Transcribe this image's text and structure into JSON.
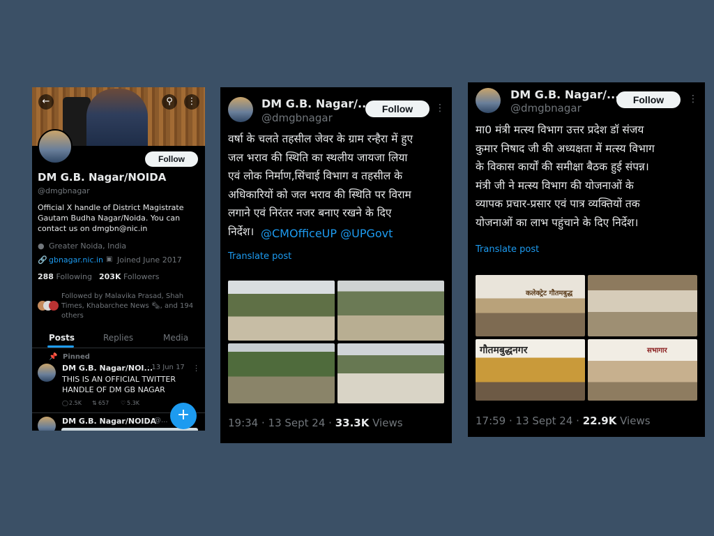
{
  "profile": {
    "name": "DM G.B. Nagar/NOIDA",
    "handle": "@dmgbnagar",
    "follow_label": "Follow",
    "bio_lines": [
      "Official X handle of District Magistrate",
      "Gautam Budha Nagar/Noida. You can",
      "contact us on dmgbn@nic.in"
    ],
    "location": "Greater Noida, India",
    "website": "gbnagar.nic.in",
    "joined": "Joined June 2017",
    "following_count": "288",
    "following_label": "Following",
    "followers_count": "203K",
    "followers_label": "Followers",
    "followed_by_lines": [
      "Followed by Malavika Prasad, Shah",
      "Times, Khabarchee News 🗞, and 194",
      "others"
    ],
    "tabs": [
      "Posts",
      "Replies",
      "Media"
    ],
    "pinned_label": "Pinned",
    "pinned_tweet": {
      "author": "DM G.B. Nagar/NOI...",
      "date": "· 13 Jun 17",
      "text_lines": [
        "THIS IS AN OFFICIAL TWITTER",
        "HANDLE OF DM GB NAGAR"
      ],
      "replies": "2.5K",
      "retweets": "657",
      "likes": "5.3K"
    },
    "next_tweet_author": "DM G.B. Nagar/NOIDA",
    "next_tweet_handle": "@..."
  },
  "post1": {
    "name": "DM G.B. Nagar/...",
    "handle": "@dmgbnagar",
    "follow_label": "Follow",
    "text": "वर्षा के चलते तहसील जेवर के ग्राम रन्हैरा में हुए\nजल भराव की स्थिति का स्थलीय जायजा लिया\nएवं लोक निर्माण,सिंचाई विभाग व तहसील के\nअधिकारियों को जल भराव की स्थिति पर विराम\nलगाने एवं निरंतर नजर बनाए रखने के दिए\nनिर्देश।",
    "mentions": "@CMOfficeUP @UPGovt",
    "translate": "Translate post",
    "time": "19:34 · 13 Sept 24 · ",
    "views_count": "33.3K",
    "views_label": " Views"
  },
  "post2": {
    "name": "DM G.B. Nagar/...",
    "handle": "@dmgbnagar",
    "follow_label": "Follow",
    "text": "मा0 मंत्री मत्स्य विभाग उत्तर प्रदेश डॉ संजय\nकुमार निषाद जी की अध्यक्षता में मत्स्य विभाग\nके विकास कार्यों की समीक्षा बैठक हुई संपन्न।\nमंत्री जी ने मत्स्य विभाग की योजनाओं के\nव्यापक प्रचार-प्रसार एवं पात्र व्यक्तियों तक\nयोजनाओं का लाभ पहुंचाने के दिए निर्देश।",
    "translate": "Translate post",
    "photo_text_1": "कलेक्ट्रेट गौतमबुद्ध",
    "photo_text_2": "गौतमबुद्धनगर",
    "photo_text_3": "सभागार",
    "time": "17:59 · 13 Sept 24 · ",
    "views_count": "22.9K",
    "views_label": " Views"
  },
  "colors": {
    "background": "#3b5066",
    "link": "#1d9bf0",
    "muted": "#71767b",
    "panel": "#000000"
  },
  "icons": [
    "back-arrow-icon",
    "search-icon",
    "more-vertical-icon",
    "location-pin-icon",
    "link-icon",
    "calendar-icon",
    "pin-icon",
    "reply-icon",
    "retweet-icon",
    "like-icon",
    "plus-icon"
  ]
}
